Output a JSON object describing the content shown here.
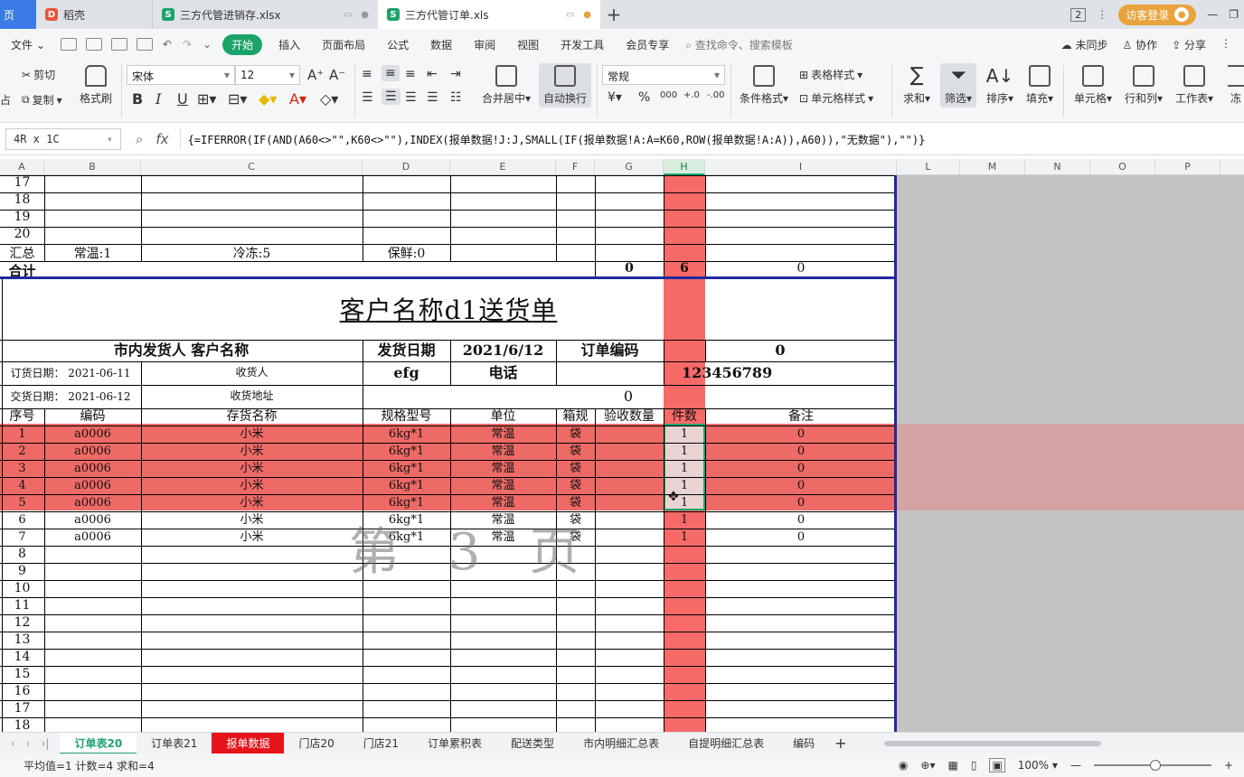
{
  "tabs": {
    "home": "页",
    "t1": "稻壳",
    "t2": "三方代管进销存.xlsx",
    "t3": "三方代管订单.xls"
  },
  "titlebar": {
    "badge": "2",
    "login": "访客登录"
  },
  "menu": {
    "file": "文件",
    "items": [
      "开始",
      "插入",
      "页面布局",
      "公式",
      "数据",
      "审阅",
      "视图",
      "开发工具",
      "会员专享"
    ],
    "search": "查找命令、搜索模板",
    "right": [
      "未同步",
      "协作",
      "分享"
    ]
  },
  "ribbon": {
    "cut": "剪切",
    "paste": "占",
    "copy": "复制",
    "format_painter": "格式刷",
    "font_name": "宋体",
    "font_size": "12",
    "merge": "合并居中",
    "wrap": "自动换行",
    "number_format": "常规",
    "cond_format": "条件格式",
    "table_style": "表格样式",
    "cell_style": "单元格样式",
    "sum": "求和",
    "filter": "筛选",
    "sort": "排序",
    "fill": "填充",
    "cell": "单元格",
    "rowcol": "行和列",
    "worksheet": "工作表",
    "freeze": "冻"
  },
  "formula_bar": {
    "name_box": "4R x 1C",
    "fx": "fx",
    "formula": "{=IFERROR(IF(AND(A60<>\"\",K60<>\"\"),INDEX(报单数据!J:J,SMALL(IF(报单数据!A:A=K60,ROW(报单数据!A:A)),A60)),\"无数据\"),\"\")}"
  },
  "columns": [
    "A",
    "B",
    "C",
    "D",
    "E",
    "F",
    "G",
    "H",
    "I",
    "L",
    "M",
    "N",
    "O",
    "P"
  ],
  "sheet": {
    "top_rows": [
      "17",
      "18",
      "19",
      "20"
    ],
    "summary": {
      "label": "汇总",
      "b": "常温:1",
      "c": "冷冻:5",
      "d": "保鲜:0"
    },
    "total": {
      "label": "合计",
      "g": "0",
      "h": "6",
      "i": "0"
    },
    "title": "客户名称d1送货单",
    "header1": {
      "sender": "市内发货人  客户名称",
      "ship_date_label": "发货日期",
      "ship_date": "2021/6/12",
      "order_no_label": "订单编码",
      "order_no": "0"
    },
    "header2": {
      "order_date": "订货日期：  2021-06-11",
      "receiver_label": "收货人",
      "receiver": "efg",
      "phone_label": "电话",
      "phone": "123456789"
    },
    "header3": {
      "delivery_date": "交货日期：  2021-06-12",
      "address_label": "收货地址",
      "address": "0"
    },
    "table_head": [
      "序号",
      "编码",
      "存货名称",
      "规格型号",
      "单位",
      "箱规",
      "验收数量",
      "件数",
      "备注"
    ],
    "items": [
      {
        "no": "1",
        "code": "a0006",
        "name": "小米",
        "spec": "6kg*1",
        "unit": "常温",
        "box": "袋",
        "qty": "",
        "count": "1",
        "note": "0"
      },
      {
        "no": "2",
        "code": "a0006",
        "name": "小米",
        "spec": "6kg*1",
        "unit": "常温",
        "box": "袋",
        "qty": "",
        "count": "1",
        "note": "0"
      },
      {
        "no": "3",
        "code": "a0006",
        "name": "小米",
        "spec": "6kg*1",
        "unit": "常温",
        "box": "袋",
        "qty": "",
        "count": "1",
        "note": "0"
      },
      {
        "no": "4",
        "code": "a0006",
        "name": "小米",
        "spec": "6kg*1",
        "unit": "常温",
        "box": "袋",
        "qty": "",
        "count": "1",
        "note": "0"
      },
      {
        "no": "5",
        "code": "a0006",
        "name": "小米",
        "spec": "6kg*1",
        "unit": "常温",
        "box": "袋",
        "qty": "",
        "count": "1",
        "note": "0"
      },
      {
        "no": "6",
        "code": "a0006",
        "name": "小米",
        "spec": "6kg*1",
        "unit": "常温",
        "box": "袋",
        "qty": "",
        "count": "1",
        "note": "0"
      },
      {
        "no": "7",
        "code": "a0006",
        "name": "小米",
        "spec": "6kg*1",
        "unit": "常温",
        "box": "袋",
        "qty": "",
        "count": "1",
        "note": "0"
      }
    ],
    "empty_rows": [
      "8",
      "9",
      "10",
      "11",
      "12",
      "13",
      "14",
      "15",
      "16",
      "17",
      "18"
    ],
    "watermark": "第 3 页"
  },
  "sheet_tabs": [
    "订单表20",
    "订单表21",
    "报单数据",
    "门店20",
    "门店21",
    "订单累积表",
    "配送类型",
    "市内明细汇总表",
    "自提明细汇总表",
    "编码"
  ],
  "status": {
    "text": "平均值=1  计数=4  求和=4",
    "zoom": "100%"
  },
  "colors": {
    "accent": "#1ca36a",
    "highlight_red": "#f76a68",
    "tab_red": "#e6151b",
    "page_border": "#1f2aa0"
  }
}
